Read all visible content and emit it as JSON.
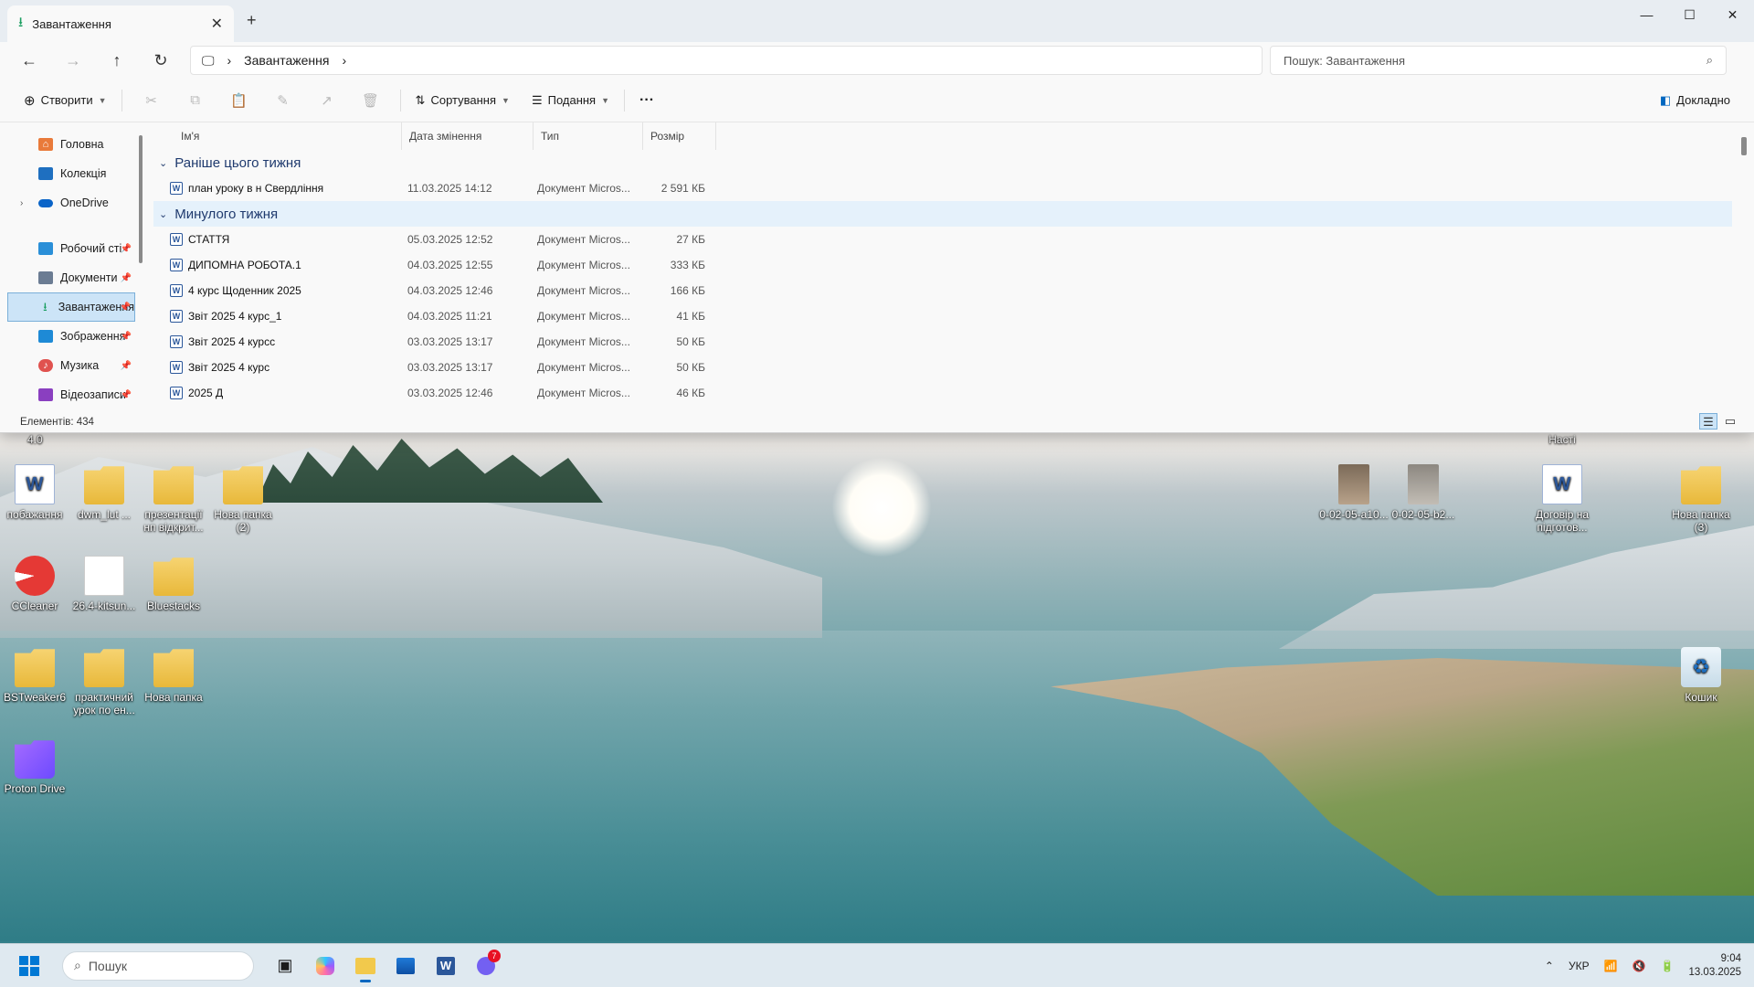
{
  "window": {
    "tab_title": "Завантаження",
    "breadcrumb": "Завантаження",
    "search_placeholder": "Пошук: Завантаження"
  },
  "toolbar": {
    "create": "Створити",
    "sort": "Сортування",
    "view": "Подання",
    "more": "···",
    "details": "Докладно"
  },
  "sidebar": {
    "items": [
      {
        "label": "Головна",
        "icon": "home-icon"
      },
      {
        "label": "Колекція",
        "icon": "gallery-icon"
      },
      {
        "label": "OneDrive",
        "icon": "onedrive-icon"
      },
      {
        "label": "Робочий сті",
        "icon": "desktop-icon"
      },
      {
        "label": "Документи",
        "icon": "documents-icon"
      },
      {
        "label": "Завантаження",
        "icon": "download-icon"
      },
      {
        "label": "Зображення",
        "icon": "pictures-icon"
      },
      {
        "label": "Музика",
        "icon": "music-icon"
      },
      {
        "label": "Відеозаписи",
        "icon": "videos-icon"
      }
    ]
  },
  "status": "Елементів: 434",
  "columns": {
    "name": "Ім'я",
    "date": "Дата змінення",
    "type": "Тип",
    "size": "Розмір"
  },
  "groups": [
    {
      "title": "Раніше цього тижня",
      "rows": [
        {
          "name": "план уроку в н Свердління",
          "date": "11.03.2025 14:12",
          "type": "Документ Micros...",
          "size": "2 591 КБ"
        }
      ]
    },
    {
      "title": "Минулого тижня",
      "rows": [
        {
          "name": "СТАТТЯ",
          "date": "05.03.2025 12:52",
          "type": "Документ Micros...",
          "size": "27 КБ"
        },
        {
          "name": "ДИПОМНА РОБОТА.1",
          "date": "04.03.2025 12:55",
          "type": "Документ Micros...",
          "size": "333 КБ"
        },
        {
          "name": "4 курс Щоденник 2025",
          "date": "04.03.2025 12:46",
          "type": "Документ Micros...",
          "size": "166 КБ"
        },
        {
          "name": "Звіт 2025 4 курс_1",
          "date": "04.03.2025 11:21",
          "type": "Документ Micros...",
          "size": "41 КБ"
        },
        {
          "name": "Звіт 2025 4 курсс",
          "date": "03.03.2025 13:17",
          "type": "Документ Micros...",
          "size": "50 КБ"
        },
        {
          "name": "Звіт 2025 4 курс",
          "date": "03.03.2025 13:17",
          "type": "Документ Micros...",
          "size": "50 КБ"
        },
        {
          "name": "2025 Д",
          "date": "03.03.2025 12:46",
          "type": "Документ Micros...",
          "size": "46 КБ"
        }
      ]
    }
  ],
  "desktop": {
    "partial_top_left": "4.0",
    "partial_top_right": "Насті",
    "icons": [
      {
        "label": "побажання",
        "kind": "word"
      },
      {
        "label": "dwm_lut ...",
        "kind": "folder"
      },
      {
        "label": "презентації нп відкрит...",
        "kind": "folder"
      },
      {
        "label": "Нова папка (2)",
        "kind": "folder"
      },
      {
        "label": "CCleaner",
        "kind": "app"
      },
      {
        "label": "26.4-kitsun...",
        "kind": "file"
      },
      {
        "label": "Bluestacks",
        "kind": "folder"
      },
      {
        "label": "BSTweaker6",
        "kind": "folder"
      },
      {
        "label": "практичний урок по ен...",
        "kind": "folder"
      },
      {
        "label": "Нова папка",
        "kind": "folder"
      },
      {
        "label": "Proton Drive",
        "kind": "app"
      },
      {
        "label": "0-02-05-a10...",
        "kind": "image"
      },
      {
        "label": "0-02-05-b2...",
        "kind": "image"
      },
      {
        "label": "Договір на підготов...",
        "kind": "word"
      },
      {
        "label": "Нова папка (3)",
        "kind": "folder"
      },
      {
        "label": "Кошик",
        "kind": "recycle"
      }
    ]
  },
  "taskbar": {
    "search": "Пошук",
    "language": "УКР",
    "time": "9:04",
    "date": "13.03.2025",
    "viber_badge": "7"
  },
  "colors": {
    "accent": "#0067c0",
    "selection": "#cce4f7",
    "group_title": "#1f3a6e"
  }
}
